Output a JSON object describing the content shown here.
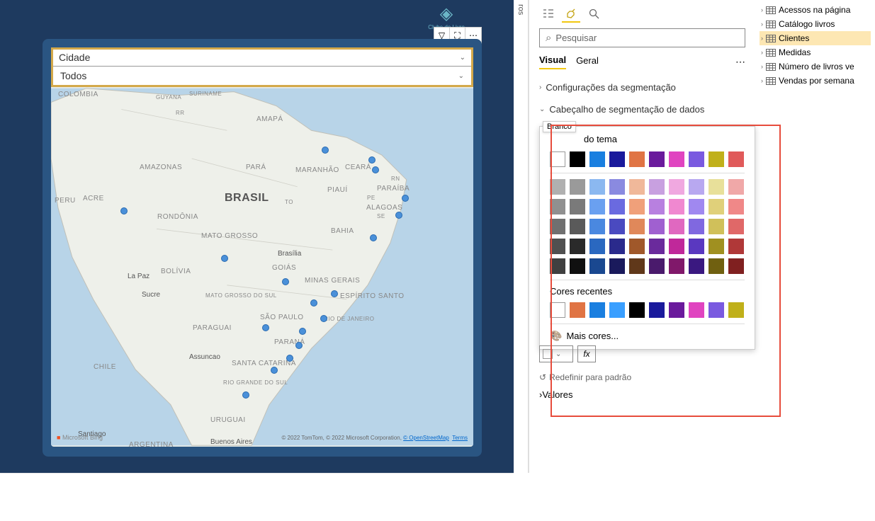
{
  "logo_text": "Clube do Livro",
  "slicer": {
    "title": "Cidade",
    "value": "Todos"
  },
  "map": {
    "country": "BRASIL",
    "regions": [
      "COLOMBIA",
      "PERU",
      "BOLÍVIA",
      "PARAGUAI",
      "CHILE",
      "URUGUAI",
      "ARGENTINA",
      "GUYANA",
      "SURINAME"
    ],
    "states": [
      "AMAZONAS",
      "PARÁ",
      "MARANHÃO",
      "CEARÁ",
      "PIAUÍ",
      "PARAÍBA",
      "ALAGOAS",
      "BAHIA",
      "MATO GROSSO",
      "GOIÁS",
      "MINAS GERAIS",
      "ESPÍRITO SANTO",
      "MATO GROSSO DO SUL",
      "SÃO PAULO",
      "RIO DE JANEIRO",
      "PARANÁ",
      "SANTA CATARINA",
      "RIO GRANDE DO SUL",
      "RONDÔNIA",
      "ACRE",
      "RN",
      "RR",
      "PE",
      "SE",
      "AMAPÁ",
      "TO"
    ],
    "cities": [
      "Brasília",
      "La Paz",
      "Sucre",
      "Assuncao",
      "Santiago",
      "Buenos Aires"
    ],
    "attribution": {
      "bing": "Microsoft Bing",
      "copyright": "© 2022 TomTom, © 2022 Microsoft Corporation,",
      "osm": "© OpenStreetMap",
      "terms": "Terms"
    }
  },
  "format_pane": {
    "search_placeholder": "Pesquisar",
    "tabs": {
      "visual": "Visual",
      "general": "Geral"
    },
    "sections": {
      "slicer_settings": "Configurações da segmentação",
      "slicer_header": "Cabeçalho de segmentação de dados",
      "values": "Valores"
    },
    "color": {
      "tooltip": "Branco",
      "theme_suffix": "do tema",
      "recent_label": "Cores recentes",
      "more": "Mais cores...",
      "fx": "fx",
      "theme_row": [
        "#FFFFFF",
        "#000000",
        "#1a7fe0",
        "#1a1a9c",
        "#e07444",
        "#6a1a9c",
        "#e044c0",
        "#7a5ae0",
        "#c0b01a",
        "#e05a5a"
      ],
      "shade_rows": [
        [
          "#b0b0b0",
          "#9a9a9a",
          "#8bb8f0",
          "#8a8ae0",
          "#f0b89a",
          "#c8a0e0",
          "#f0a8e0",
          "#b8a8f0",
          "#e8e09a",
          "#f0a8a8"
        ],
        [
          "#909090",
          "#7a7a7a",
          "#6aa0f0",
          "#6a6ae0",
          "#f0a07a",
          "#b880e0",
          "#f088d0",
          "#a088f0",
          "#e0d07a",
          "#f08888"
        ],
        [
          "#707070",
          "#5a5a5a",
          "#4a88e0",
          "#4a4ac0",
          "#e0885a",
          "#a060d0",
          "#e068c0",
          "#8068e0",
          "#d0c05a",
          "#e06868"
        ],
        [
          "#505050",
          "#2a2a2a",
          "#2a68c0",
          "#2a2a8c",
          "#a0582a",
          "#6a2a9c",
          "#c0289a",
          "#5a38c0",
          "#a09020",
          "#b03838"
        ],
        [
          "#404040",
          "#101010",
          "#1a4890",
          "#1a1a5c",
          "#60381a",
          "#4a1a6c",
          "#80186a",
          "#3a1880",
          "#706010",
          "#802020"
        ]
      ],
      "recent_row": [
        "#FFFFFF",
        "#e07444",
        "#1a7fe0",
        "#3a9fff",
        "#000000",
        "#1a1a9c",
        "#6a1a9c",
        "#e044c0",
        "#7a5ae0",
        "#c0b01a"
      ]
    },
    "reset": "Redefinir para padrão"
  },
  "fields": {
    "items": [
      {
        "label": "Acessos na página"
      },
      {
        "label": "Catálogo livros"
      },
      {
        "label": "Clientes",
        "highlight": true
      },
      {
        "label": "Medidas"
      },
      {
        "label": "Número de livros ve"
      },
      {
        "label": "Vendas por semana"
      }
    ]
  },
  "side_tab": "ros"
}
